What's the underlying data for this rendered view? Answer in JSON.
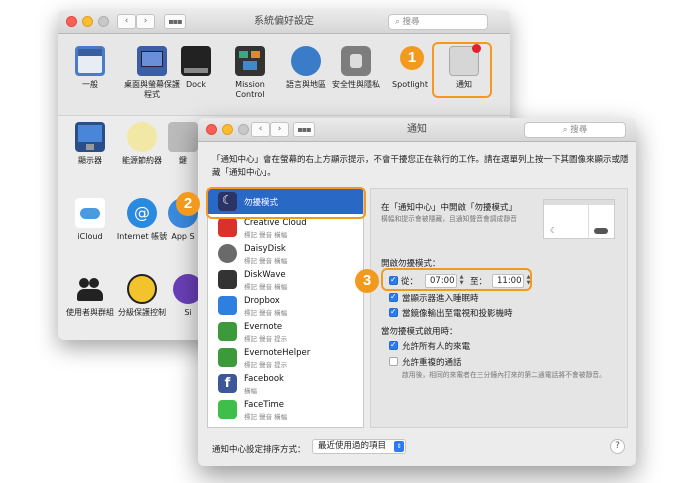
{
  "back_window": {
    "title": "系統偏好設定",
    "search_placeholder": "搜尋",
    "row1": [
      {
        "label": "一般",
        "icon": "general-icon"
      },
      {
        "label": "桌面與螢幕保護程式",
        "icon": "desktop-icon"
      },
      {
        "label": "Dock",
        "icon": "dock-icon"
      },
      {
        "label": "Mission Control",
        "icon": "mission-control-icon"
      },
      {
        "label": "語言與地區",
        "icon": "language-region-icon"
      },
      {
        "label": "安全性與隱私",
        "icon": "security-icon"
      },
      {
        "label": "Spotlight",
        "icon": "spotlight-icon"
      },
      {
        "label": "通知",
        "icon": "notifications-icon"
      }
    ],
    "row2": [
      {
        "label": "顯示器",
        "icon": "display-icon"
      },
      {
        "label": "能源節約器",
        "icon": "energy-saver-icon"
      },
      {
        "label": "鍵",
        "icon": "keyboard-icon"
      }
    ],
    "row3": [
      {
        "label": "iCloud",
        "icon": "icloud-icon"
      },
      {
        "label": "Internet 帳號",
        "icon": "internet-accounts-icon"
      },
      {
        "label": "App S",
        "icon": "app-store-icon"
      }
    ],
    "row4": [
      {
        "label": "使用者與群組",
        "icon": "users-groups-icon"
      },
      {
        "label": "分級保護控制",
        "icon": "parental-controls-icon"
      },
      {
        "label": "Si",
        "icon": "siri-icon"
      }
    ]
  },
  "front_window": {
    "title": "通知",
    "search_placeholder": "搜尋",
    "description": "「通知中心」會在螢幕的右上方顯示提示，不會干擾您正在執行的工作。請在選單列上按一下其圖像來顯示或隱藏「通知中心」。",
    "apps": [
      {
        "name": "勿擾模式",
        "sub": "",
        "icon": "do-not-disturb-icon",
        "color": "#2a3466"
      },
      {
        "name": "Creative Cloud",
        "sub": "標記 聲音 橫幅",
        "icon": "creative-cloud-icon",
        "color": "#d8322b"
      },
      {
        "name": "DaisyDisk",
        "sub": "標記 聲音 橫幅",
        "icon": "daisydisk-icon",
        "color": "#6a6a6a"
      },
      {
        "name": "DiskWave",
        "sub": "標記 聲音 橫幅",
        "icon": "diskwave-icon",
        "color": "#333333"
      },
      {
        "name": "Dropbox",
        "sub": "標記 聲音 橫幅",
        "icon": "dropbox-icon",
        "color": "#2d7fe0"
      },
      {
        "name": "Evernote",
        "sub": "標記 聲音 提示",
        "icon": "evernote-icon",
        "color": "#3d9a3a"
      },
      {
        "name": "EvernoteHelper",
        "sub": "標記 聲音 提示",
        "icon": "evernote-helper-icon",
        "color": "#3d9a3a"
      },
      {
        "name": "Facebook",
        "sub": "橫幅",
        "icon": "facebook-icon",
        "color": "#3b5998"
      },
      {
        "name": "FaceTime",
        "sub": "標記 聲音 橫幅",
        "icon": "facetime-icon",
        "color": "#3fbf4a"
      }
    ],
    "dnd": {
      "heading": "在「通知中心」中開啟「勿擾模式」",
      "explain": "橫幅和提示會被隱藏，且通知聲音會調成靜音",
      "turn_on_label": "開啟勿擾模式：",
      "from_label": "從：",
      "from_time": "07:00",
      "to_label": "至：",
      "to_time": "11:00",
      "opt_display_sleep": "當顯示器進入睡眠時",
      "opt_mirroring": "當鏡像輸出至電視和投影機時",
      "when_on_label": "當勿擾模式啟用時：",
      "allow_calls_everyone": "允許所有人的來電",
      "allow_repeated_calls": "允許重複的通話",
      "repeated_explain": "啟用後，相同的來電者在三分鐘內打來的第二通電話將不會被靜音。"
    },
    "footer": {
      "sort_label": "通知中心設定排序方式：",
      "sort_value": "最近使用過的項目",
      "help": "?"
    }
  },
  "callouts": {
    "one": "1",
    "two": "2",
    "three": "3"
  },
  "colors": {
    "accent": "#f39a1e",
    "selection": "#2a68c6",
    "checkbox": "#2c7cf0"
  }
}
